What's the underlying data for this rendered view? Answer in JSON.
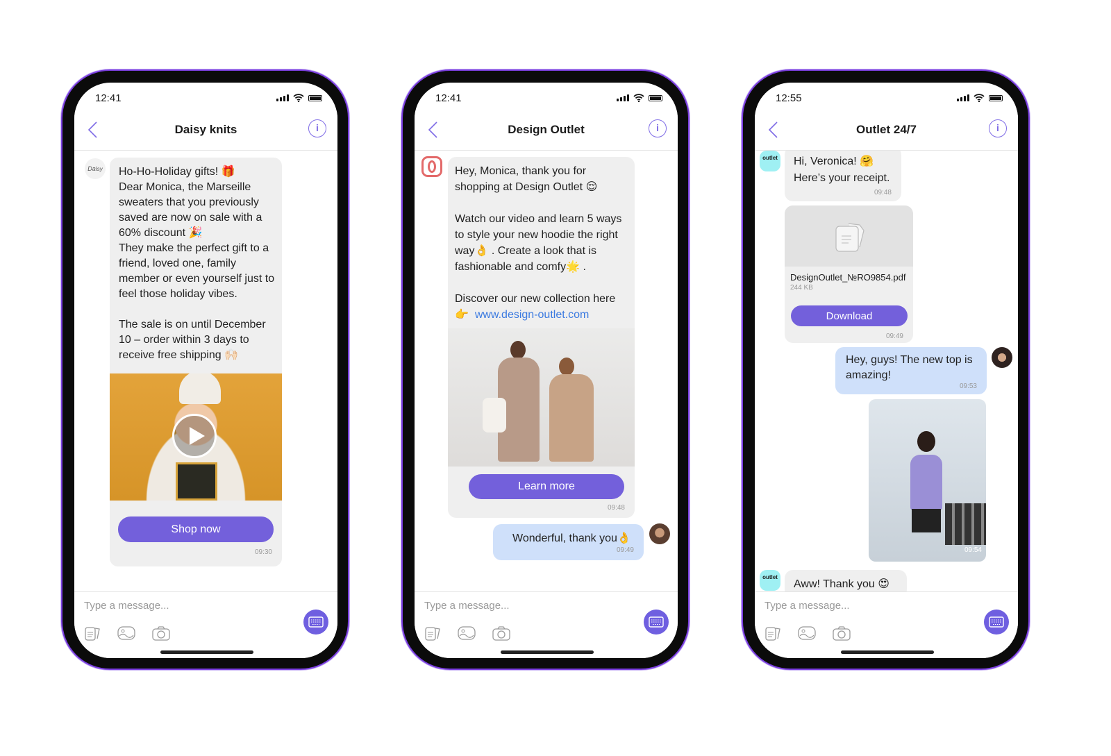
{
  "colors": {
    "accent": "#7360db",
    "frame": "#7b3fe0",
    "bubble_in": "#efefef",
    "bubble_out": "#cfe0fa",
    "link": "#3b7ae0"
  },
  "composer": {
    "placeholder": "Type a message...",
    "icons": [
      "document-icon",
      "image-icon",
      "camera-icon",
      "keyboard-icon"
    ]
  },
  "phones": [
    {
      "time": "12:41",
      "title": "Daisy knits",
      "avatar_label": "Daisy",
      "message": "Ho-Ho-Holiday gifts! 🎁\nDear Monica, the Marseille sweaters that you previously saved are now on sale with a 60% discount 🎉\nThey make the perfect gift to a friend, loved one, family member or even yourself just to feel those holiday vibes.\n\nThe sale is on until December 10 – order within 3 days to receive free shipping 🙌🏻",
      "button": "Shop now",
      "timestamp": "09:30"
    },
    {
      "time": "12:41",
      "title": "Design Outlet",
      "message": "Hey, Monica, thank you for shopping at Design Outlet 😌\n\nWatch our video and learn 5 ways to style your new hoodie the right way👌 . Create a look that is fashionable and comfy🌟 .\n\nDiscover our new collection here",
      "link_prefix": "👉",
      "link": "www.design-outlet.com",
      "button": "Learn more",
      "timestamp": "09:48",
      "reply": "Wonderful, thank you👌",
      "reply_timestamp": "09:49"
    },
    {
      "time": "12:55",
      "title": "Outlet 24/7",
      "avatar_label": "outlet",
      "message": "Hi, Veronica! 🤗\nHere’s your receipt.",
      "timestamp": "09:48",
      "file_name": "DesignOutlet_№RO9854.pdf",
      "file_size": "244 KB",
      "button": "Download",
      "file_timestamp": "09:49",
      "reply": "Hey, guys! The new top is amazing!",
      "reply_timestamp": "09:53",
      "photo_timestamp": "09:54",
      "last_message": "Aww! Thank you 😍"
    }
  ]
}
